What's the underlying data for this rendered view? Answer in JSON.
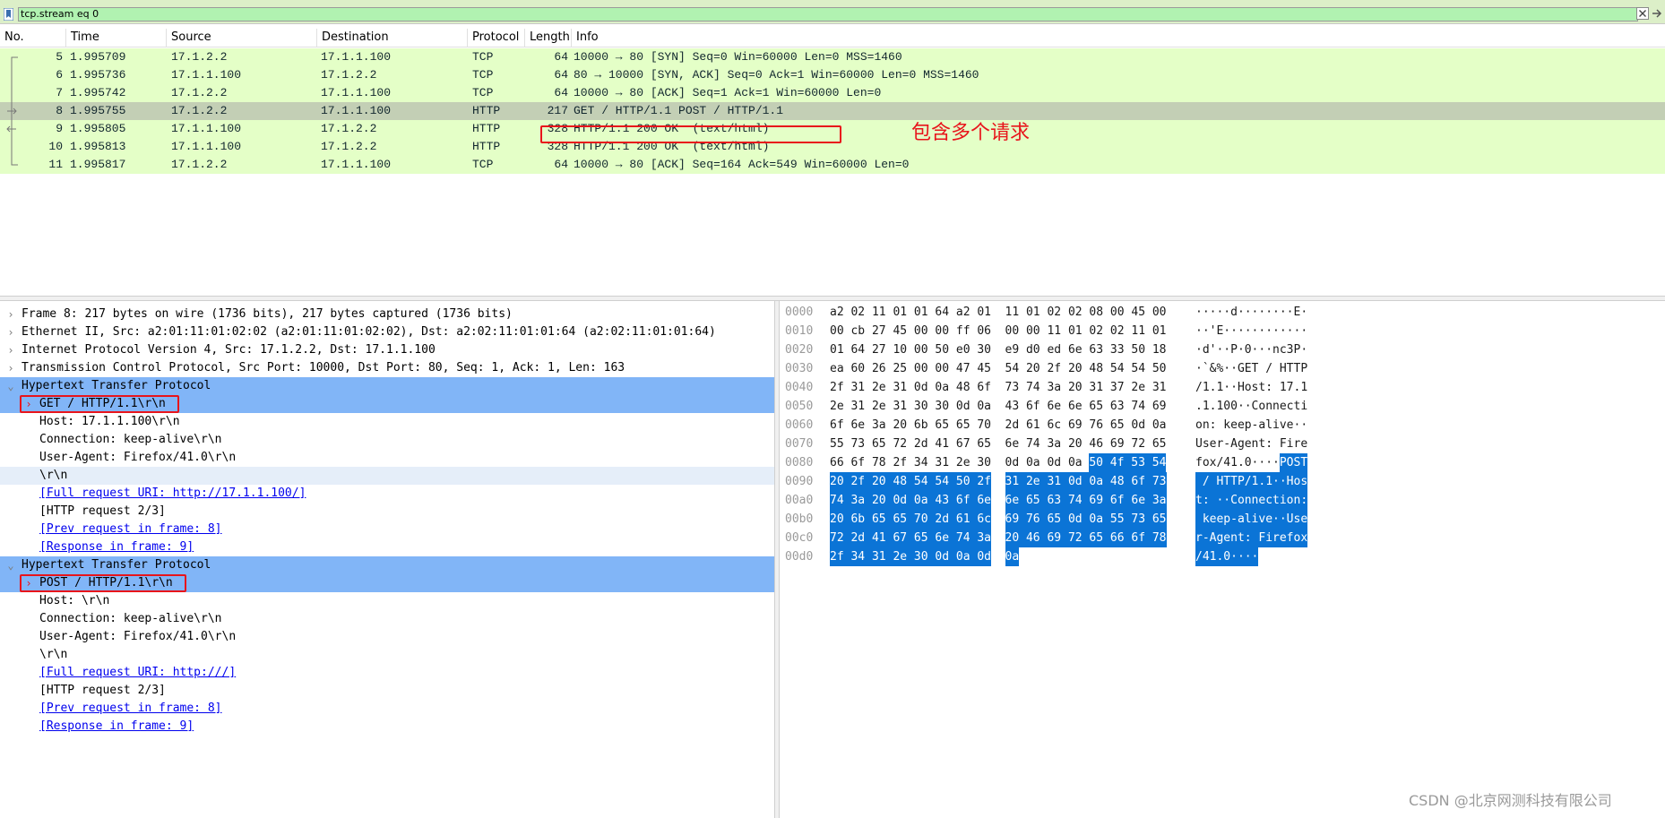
{
  "filter": {
    "value": "tcp.stream eq 0"
  },
  "packet_list": {
    "columns": [
      "No.",
      "Time",
      "Source",
      "Destination",
      "Protocol",
      "Length",
      "Info"
    ],
    "rows": [
      {
        "no": "5",
        "time": "1.995709",
        "src": "17.1.2.2",
        "dst": "17.1.1.100",
        "proto": "TCP",
        "len": "64",
        "info": "10000 → 80 [SYN] Seq=0 Win=60000 Len=0 MSS=1460",
        "selected": false
      },
      {
        "no": "6",
        "time": "1.995736",
        "src": "17.1.1.100",
        "dst": "17.1.2.2",
        "proto": "TCP",
        "len": "64",
        "info": "80 → 10000 [SYN, ACK] Seq=0 Ack=1 Win=60000 Len=0 MSS=1460",
        "selected": false
      },
      {
        "no": "7",
        "time": "1.995742",
        "src": "17.1.2.2",
        "dst": "17.1.1.100",
        "proto": "TCP",
        "len": "64",
        "info": "10000 → 80 [ACK] Seq=1 Ack=1 Win=60000 Len=0",
        "selected": false
      },
      {
        "no": "8",
        "time": "1.995755",
        "src": "17.1.2.2",
        "dst": "17.1.1.100",
        "proto": "HTTP",
        "len": "217",
        "info": "GET / HTTP/1.1 POST / HTTP/1.1",
        "selected": true
      },
      {
        "no": "9",
        "time": "1.995805",
        "src": "17.1.1.100",
        "dst": "17.1.2.2",
        "proto": "HTTP",
        "len": "328",
        "info": "HTTP/1.1 200 OK  (text/html)",
        "selected": false
      },
      {
        "no": "10",
        "time": "1.995813",
        "src": "17.1.1.100",
        "dst": "17.1.2.2",
        "proto": "HTTP",
        "len": "328",
        "info": "HTTP/1.1 200 OK  (text/html)",
        "selected": false
      },
      {
        "no": "11",
        "time": "1.995817",
        "src": "17.1.2.2",
        "dst": "17.1.1.100",
        "proto": "TCP",
        "len": "64",
        "info": "10000 → 80 [ACK] Seq=164 Ack=549 Win=60000 Len=0",
        "selected": false
      }
    ]
  },
  "annotation": {
    "text": "包含多个请求",
    "color": "#e8141b"
  },
  "details": {
    "rows": [
      {
        "indent": 0,
        "expander": "closed",
        "text": "Frame 8: 217 bytes on wire (1736 bits), 217 bytes captured (1736 bits)",
        "style": "normal"
      },
      {
        "indent": 0,
        "expander": "closed",
        "text": "Ethernet II, Src: a2:01:11:01:02:02 (a2:01:11:01:02:02), Dst: a2:02:11:01:01:64 (a2:02:11:01:01:64)",
        "style": "normal"
      },
      {
        "indent": 0,
        "expander": "closed",
        "text": "Internet Protocol Version 4, Src: 17.1.2.2, Dst: 17.1.1.100",
        "style": "normal"
      },
      {
        "indent": 0,
        "expander": "closed",
        "text": "Transmission Control Protocol, Src Port: 10000, Dst Port: 80, Seq: 1, Ack: 1, Len: 163",
        "style": "normal"
      },
      {
        "indent": 0,
        "expander": "open",
        "text": "Hypertext Transfer Protocol",
        "style": "selected"
      },
      {
        "indent": 1,
        "expander": "closed",
        "text": "GET / HTTP/1.1\\r\\n",
        "style": "selected",
        "boxed": true
      },
      {
        "indent": 1,
        "expander": "none",
        "text": "Host: 17.1.1.100\\r\\n",
        "style": "normal"
      },
      {
        "indent": 1,
        "expander": "none",
        "text": "Connection: keep-alive\\r\\n",
        "style": "normal"
      },
      {
        "indent": 1,
        "expander": "none",
        "text": "User-Agent: Firefox/41.0\\r\\n",
        "style": "normal"
      },
      {
        "indent": 1,
        "expander": "none",
        "text": "\\r\\n",
        "style": "sub"
      },
      {
        "indent": 1,
        "expander": "none",
        "text": "[Full request URI: http://17.1.1.100/]",
        "style": "link"
      },
      {
        "indent": 1,
        "expander": "none",
        "text": "[HTTP request 2/3]",
        "style": "normal"
      },
      {
        "indent": 1,
        "expander": "none",
        "text": "[Prev request in frame: 8]",
        "style": "link"
      },
      {
        "indent": 1,
        "expander": "none",
        "text": "[Response in frame: 9]",
        "style": "link"
      },
      {
        "indent": 0,
        "expander": "open",
        "text": "Hypertext Transfer Protocol",
        "style": "selected"
      },
      {
        "indent": 1,
        "expander": "closed",
        "text": "POST / HTTP/1.1\\r\\n",
        "style": "selected",
        "boxed": true
      },
      {
        "indent": 1,
        "expander": "none",
        "text": "Host: \\r\\n",
        "style": "normal"
      },
      {
        "indent": 1,
        "expander": "none",
        "text": "Connection: keep-alive\\r\\n",
        "style": "normal"
      },
      {
        "indent": 1,
        "expander": "none",
        "text": "User-Agent: Firefox/41.0\\r\\n",
        "style": "normal"
      },
      {
        "indent": 1,
        "expander": "none",
        "text": "\\r\\n",
        "style": "normal"
      },
      {
        "indent": 1,
        "expander": "none",
        "text": "[Full request URI: http:///]",
        "style": "link"
      },
      {
        "indent": 1,
        "expander": "none",
        "text": "[HTTP request 2/3]",
        "style": "normal"
      },
      {
        "indent": 1,
        "expander": "none",
        "text": "[Prev request in frame: 8]",
        "style": "link"
      },
      {
        "indent": 1,
        "expander": "none",
        "text": "[Response in frame: 9]",
        "style": "link"
      }
    ]
  },
  "bytes": {
    "rows": [
      {
        "offset": "0000",
        "hex1": "a2 02 11 01 01 64 a2 01",
        "hex2": "11 01 02 02 08 00 45 00",
        "hex2_hl": "",
        "ascii1": "·····d··",
        "ascii2": "······E·",
        "ascii2_hl": ""
      },
      {
        "offset": "0010",
        "hex1": "00 cb 27 45 00 00 ff 06",
        "hex2": "00 00 11 01 02 02 11 01",
        "hex2_hl": "",
        "ascii1": "··'E····",
        "ascii2": "········",
        "ascii2_hl": ""
      },
      {
        "offset": "0020",
        "hex1": "01 64 27 10 00 50 e0 30",
        "hex2": "e9 d0 ed 6e 63 33 50 18",
        "hex2_hl": "",
        "ascii1": "·d'··P·0",
        "ascii2": "···nc3P·",
        "ascii2_hl": ""
      },
      {
        "offset": "0030",
        "hex1": "ea 60 26 25 00 00 47 45",
        "hex2": "54 20 2f 20 48 54 54 50",
        "hex2_hl": "",
        "ascii1": "·`&%··GE",
        "ascii2": "T / HTTP",
        "ascii2_hl": ""
      },
      {
        "offset": "0040",
        "hex1": "2f 31 2e 31 0d 0a 48 6f",
        "hex2": "73 74 3a 20 31 37 2e 31",
        "hex2_hl": "",
        "ascii1": "/1.1··Ho",
        "ascii2": "st: 17.1",
        "ascii2_hl": ""
      },
      {
        "offset": "0050",
        "hex1": "2e 31 2e 31 30 30 0d 0a",
        "hex2": "43 6f 6e 6e 65 63 74 69",
        "hex2_hl": "",
        "ascii1": ".1.100··",
        "ascii2": "Connecti",
        "ascii2_hl": ""
      },
      {
        "offset": "0060",
        "hex1": "6f 6e 3a 20 6b 65 65 70",
        "hex2": "2d 61 6c 69 76 65 0d 0a",
        "hex2_hl": "",
        "ascii1": "on: keep",
        "ascii2": "-alive··",
        "ascii2_hl": ""
      },
      {
        "offset": "0070",
        "hex1": "55 73 65 72 2d 41 67 65",
        "hex2": "6e 74 3a 20 46 69 72 65",
        "hex2_hl": "",
        "ascii1": "User-Age",
        "ascii2": "nt: Fire",
        "ascii2_hl": ""
      },
      {
        "offset": "0080",
        "hex1": "66 6f 78 2f 34 31 2e 30",
        "hex2": "0d 0a 0d 0a ",
        "hex2_hl": "50 4f 53 54",
        "ascii1": "fox/41.0",
        "ascii2": "····",
        "ascii2_hl": "POST"
      },
      {
        "offset": "0090",
        "hex1": "",
        "hex1_hl": "20 2f 20 48 54 54 50 2f",
        "hex2": "",
        "hex2_hl": "31 2e 31 0d 0a 48 6f 73",
        "ascii1": "",
        "ascii1_hl": " / HTTP/",
        "ascii2": "",
        "ascii2_hl": "1.1··Hos"
      },
      {
        "offset": "00a0",
        "hex1": "",
        "hex1_hl": "74 3a 20 0d 0a 43 6f 6e",
        "hex2": "",
        "hex2_hl": "6e 65 63 74 69 6f 6e 3a",
        "ascii1": "",
        "ascii1_hl": "t: ··Con",
        "ascii2": "",
        "ascii2_hl": "nection:"
      },
      {
        "offset": "00b0",
        "hex1": "",
        "hex1_hl": "20 6b 65 65 70 2d 61 6c",
        "hex2": "",
        "hex2_hl": "69 76 65 0d 0a 55 73 65",
        "ascii1": "",
        "ascii1_hl": " keep-al",
        "ascii2": "",
        "ascii2_hl": "ive··Use"
      },
      {
        "offset": "00c0",
        "hex1": "",
        "hex1_hl": "72 2d 41 67 65 6e 74 3a",
        "hex2": "",
        "hex2_hl": "20 46 69 72 65 66 6f 78",
        "ascii1": "",
        "ascii1_hl": "r-Agent:",
        "ascii2": "",
        "ascii2_hl": " Firefox"
      },
      {
        "offset": "00d0",
        "hex1": "",
        "hex1_hl": "2f 34 31 2e 30 0d 0a 0d",
        "hex2": "",
        "hex2_hl": "0a",
        "ascii1": "",
        "ascii1_hl": "/41.0···",
        "ascii2": "",
        "ascii2_hl": "·"
      }
    ]
  },
  "watermark": "CSDN @北京网测科技有限公司",
  "colors": {
    "row_bg": "#e4ffc7",
    "row_selected": "#c3cfb5",
    "detail_selected": "#81b5f7",
    "byte_highlight": "#0b74d6",
    "filter_bg": "#b1f2b1"
  }
}
